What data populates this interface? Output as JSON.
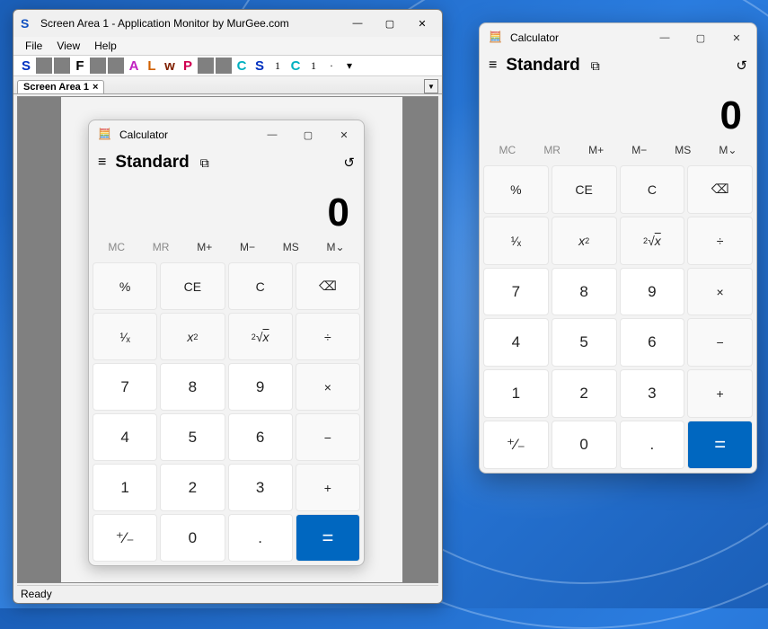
{
  "app_monitor": {
    "title": "Screen Area 1 - Application Monitor by MurGee.com",
    "menu": [
      "File",
      "View",
      "Help"
    ],
    "toolbar": [
      "S",
      "■",
      "■",
      "F",
      "■",
      "■",
      "A",
      "L",
      "w",
      "P",
      "■",
      "■",
      "C",
      "S",
      "1",
      "C",
      "1",
      "·",
      "▾"
    ],
    "tab": {
      "label": "Screen Area 1"
    },
    "status": "Ready"
  },
  "calc_common": {
    "title": "Calculator",
    "mode": "Standard",
    "display": "0",
    "memory": [
      "MC",
      "MR",
      "M+",
      "M−",
      "MS",
      "M⌄"
    ],
    "memory_enabled": [
      false,
      false,
      true,
      true,
      true,
      true
    ],
    "keys": [
      {
        "l": "%",
        "t": "func",
        "n": "percent"
      },
      {
        "l": "CE",
        "t": "func",
        "n": "clear-entry"
      },
      {
        "l": "C",
        "t": "func",
        "n": "clear"
      },
      {
        "l": "⌫",
        "t": "func",
        "n": "backspace"
      },
      {
        "l": "¹⁄ₓ",
        "t": "func",
        "n": "reciprocal"
      },
      {
        "l": "x²",
        "t": "func",
        "n": "square",
        "html": "<i>x</i><sup>2</sup>"
      },
      {
        "l": "²√x",
        "t": "func",
        "n": "sqrt",
        "html": "<sup>2</sup>√<i style='text-decoration:overline'>x</i>"
      },
      {
        "l": "÷",
        "t": "func",
        "n": "divide"
      },
      {
        "l": "7",
        "t": "num",
        "n": "seven"
      },
      {
        "l": "8",
        "t": "num",
        "n": "eight"
      },
      {
        "l": "9",
        "t": "num",
        "n": "nine"
      },
      {
        "l": "×",
        "t": "func",
        "n": "multiply"
      },
      {
        "l": "4",
        "t": "num",
        "n": "four"
      },
      {
        "l": "5",
        "t": "num",
        "n": "five"
      },
      {
        "l": "6",
        "t": "num",
        "n": "six"
      },
      {
        "l": "−",
        "t": "func",
        "n": "subtract"
      },
      {
        "l": "1",
        "t": "num",
        "n": "one"
      },
      {
        "l": "2",
        "t": "num",
        "n": "two"
      },
      {
        "l": "3",
        "t": "num",
        "n": "three"
      },
      {
        "l": "+",
        "t": "func",
        "n": "add"
      },
      {
        "l": "⁺⁄₋",
        "t": "num",
        "n": "negate"
      },
      {
        "l": "0",
        "t": "num",
        "n": "zero"
      },
      {
        "l": ".",
        "t": "num",
        "n": "decimal"
      },
      {
        "l": "=",
        "t": "eq",
        "n": "equals"
      }
    ]
  }
}
